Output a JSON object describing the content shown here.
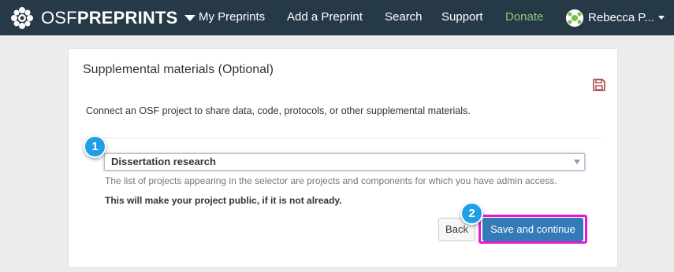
{
  "navbar": {
    "brand_osf": "OSF",
    "brand_preprints": "PREPRINTS",
    "items": [
      "My Preprints",
      "Add a Preprint",
      "Search",
      "Support"
    ],
    "donate": "Donate",
    "user_name": "Rebecca P...",
    "logo_icon": "osf-flower-logo-icon",
    "colors": {
      "background": "#263947",
      "donate": "#8fc67d"
    }
  },
  "panel": {
    "title": "Supplemental materials (Optional)",
    "save_icon": "floppy-disk-icon",
    "description": "Connect an OSF project to share data, code, protocols, or other supplemental materials.",
    "project_select": {
      "selected": "Dissertation research"
    },
    "help_text": "The list of projects appearing in the selector are projects and components for which you have admin access.",
    "warning_text": "This will make your project public, if it is not already.",
    "back_label": "Back",
    "save_label": "Save and continue"
  },
  "callouts": [
    "1",
    "2"
  ],
  "colors": {
    "primary_button": "#337ab7",
    "highlight": "#e61ad6",
    "callout": "#1ea0e6",
    "save_icon": "#a94442"
  }
}
